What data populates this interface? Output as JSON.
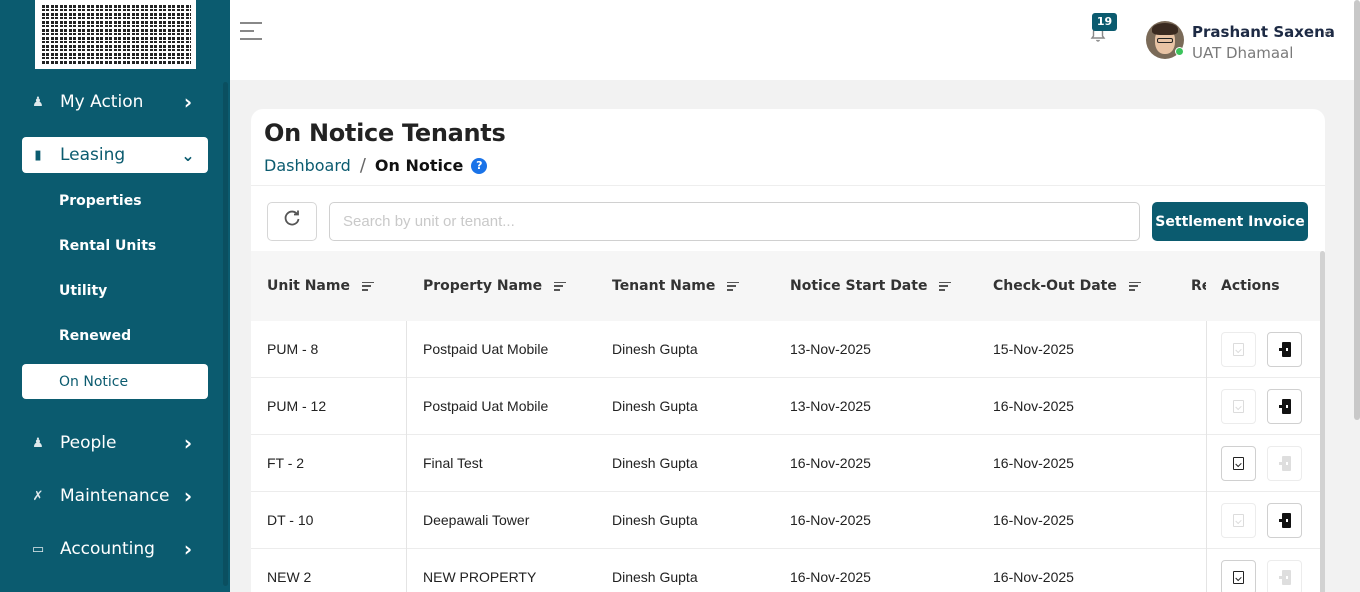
{
  "sidebar": {
    "nav": [
      {
        "label": "My Action",
        "icon": "user-tie-icon"
      },
      {
        "label": "Leasing",
        "icon": "building-icon"
      },
      {
        "label": "People",
        "icon": "person-icon"
      },
      {
        "label": "Maintenance",
        "icon": "tools-icon"
      },
      {
        "label": "Accounting",
        "icon": "wallet-icon"
      }
    ],
    "sub_items": [
      "Properties",
      "Rental Units",
      "Utility",
      "Renewed",
      "On Notice"
    ]
  },
  "header": {
    "notification_count": "19",
    "user_name": "Prashant Saxena",
    "user_org": "UAT Dhamaal"
  },
  "page": {
    "title": "On Notice Tenants",
    "breadcrumb_home": "Dashboard",
    "breadcrumb_sep": "/",
    "breadcrumb_current": "On Notice",
    "help_glyph": "?"
  },
  "toolbar": {
    "search_placeholder": "Search by unit or tenant...",
    "settlement_label": "Settlement Invoice"
  },
  "table": {
    "columns": [
      "Unit Name",
      "Property Name",
      "Tenant Name",
      "Notice Start Date",
      "Check-Out Date",
      "Re"
    ],
    "actions_header": "Actions",
    "rows": [
      {
        "unit": "PUM - 8",
        "property": "Postpaid Uat Mobile",
        "tenant": "Dinesh Gupta",
        "notice_start": "13-Nov-2025",
        "checkout": "15-Nov-2025",
        "invoice_enabled": false,
        "checkout_enabled": true
      },
      {
        "unit": "PUM - 12",
        "property": "Postpaid Uat Mobile",
        "tenant": "Dinesh Gupta",
        "notice_start": "13-Nov-2025",
        "checkout": "16-Nov-2025",
        "invoice_enabled": false,
        "checkout_enabled": true
      },
      {
        "unit": "FT - 2",
        "property": "Final Test",
        "tenant": "Dinesh Gupta",
        "notice_start": "16-Nov-2025",
        "checkout": "16-Nov-2025",
        "invoice_enabled": true,
        "checkout_enabled": false
      },
      {
        "unit": "DT - 10",
        "property": "Deepawali Tower",
        "tenant": "Dinesh Gupta",
        "notice_start": "16-Nov-2025",
        "checkout": "16-Nov-2025",
        "invoice_enabled": false,
        "checkout_enabled": true
      },
      {
        "unit": "NEW 2",
        "property": "NEW PROPERTY",
        "tenant": "Dinesh Gupta",
        "notice_start": "16-Nov-2025",
        "checkout": "16-Nov-2025",
        "invoice_enabled": true,
        "checkout_enabled": false
      }
    ]
  },
  "colors": {
    "brand": "#0b5b6f",
    "help": "#1a73e8",
    "online": "#3bc35b"
  }
}
